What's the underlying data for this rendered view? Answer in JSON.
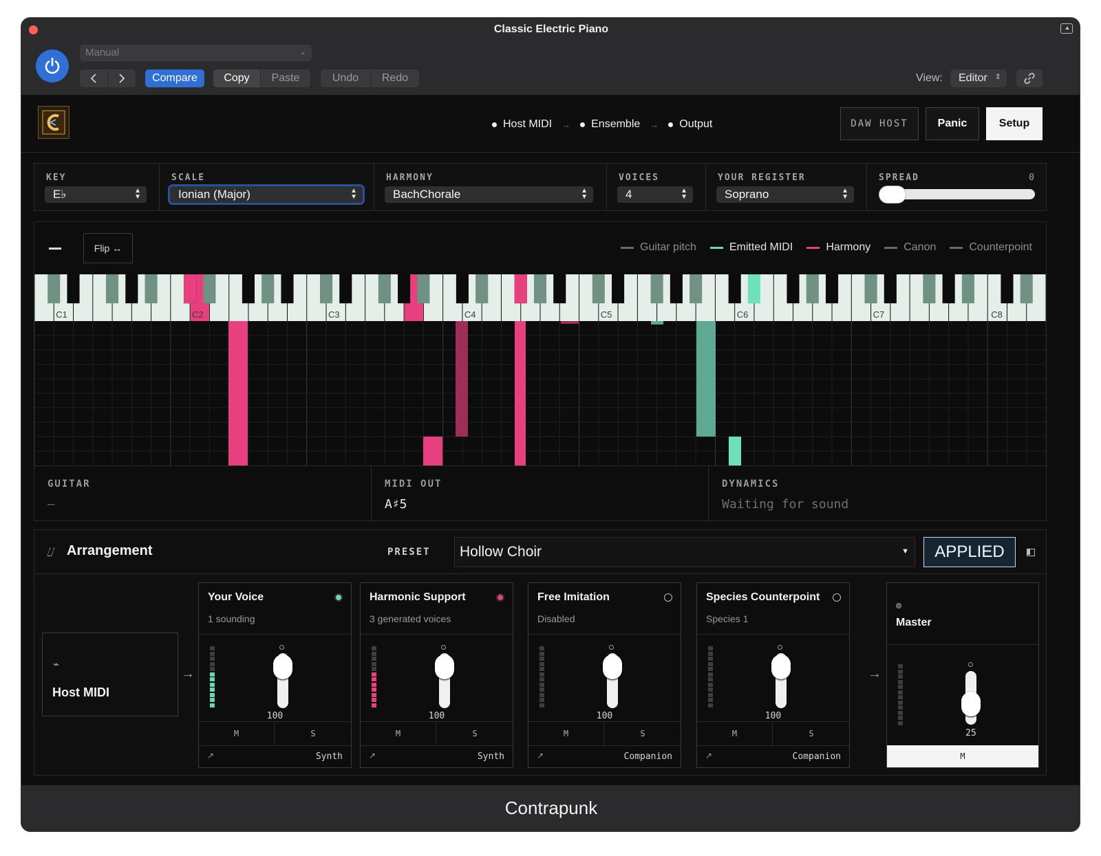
{
  "window": {
    "title": "Classic Electric Piano"
  },
  "host_toolbar": {
    "preset_select_value": "Manual",
    "compare_label": "Compare",
    "copy_label": "Copy",
    "paste_label": "Paste",
    "undo_label": "Undo",
    "redo_label": "Redo",
    "view_label": "View:",
    "view_value": "Editor"
  },
  "plugin_header": {
    "flow": [
      "Host MIDI",
      "Ensemble",
      "Output"
    ],
    "daw_host_label": "DAW HOST",
    "panic_label": "Panic",
    "setup_label": "Setup"
  },
  "controls": {
    "key": {
      "label": "KEY",
      "value": "E♭"
    },
    "scale": {
      "label": "SCALE",
      "value": "Ionian (Major)"
    },
    "harmony": {
      "label": "HARMONY",
      "value": "BachChorale"
    },
    "voices": {
      "label": "VOICES",
      "value": "4"
    },
    "register": {
      "label": "YOUR REGISTER",
      "value": "Soprano"
    },
    "spread": {
      "label": "SPREAD",
      "value": "0"
    }
  },
  "keyboard": {
    "flip_label": "Flip ↔",
    "legend": [
      {
        "name": "Guitar pitch",
        "color": "#6a6a6c"
      },
      {
        "name": "Emitted MIDI",
        "color": "#6fd6b4"
      },
      {
        "name": "Harmony",
        "color": "#e8407f"
      },
      {
        "name": "Canon",
        "color": "#6a6a6c"
      },
      {
        "name": "Counterpoint",
        "color": "#6a6a6c"
      }
    ],
    "octave_labels": [
      "C1",
      "C2",
      "C3",
      "C4",
      "C5",
      "C6",
      "C7",
      "C8"
    ],
    "colors": {
      "harmony": "#e8407f",
      "harmony_dim": "#9c2f58",
      "emitted": "#5fa894",
      "emitted_bright": "#6fe0bc",
      "white_key": "#e6eee9",
      "black_key": "#0c0c0d",
      "black_key_tint": "#6f9285"
    }
  },
  "readouts": {
    "guitar": {
      "label": "GUITAR",
      "value": "—"
    },
    "midi_out": {
      "label": "MIDI OUT",
      "value": "A♯5"
    },
    "dynamics": {
      "label": "DYNAMICS",
      "value": "Waiting for sound"
    }
  },
  "arrangement": {
    "title": "Arrangement",
    "preset_label": "PRESET",
    "preset_value": "Hollow Choir",
    "applied_label": "APPLIED",
    "source_label": "Host MIDI",
    "channels": [
      {
        "title": "Your Voice",
        "subtitle": "1 sounding",
        "status_color": "#6fd6b4",
        "status": "active",
        "meter_lit": 7,
        "meter_color": "#6fd6b4",
        "fader_value": "100",
        "mute_label": "M",
        "solo_label": "S",
        "type": "Synth"
      },
      {
        "title": "Harmonic Support",
        "subtitle": "3 generated voices",
        "status_color": "#e8407f",
        "status": "active",
        "meter_lit": 7,
        "meter_color": "#e8407f",
        "fader_value": "100",
        "mute_label": "M",
        "solo_label": "S",
        "type": "Synth"
      },
      {
        "title": "Free Imitation",
        "subtitle": "Disabled",
        "status_color": "#bbbbbb",
        "status": "off",
        "meter_lit": 0,
        "meter_color": "#3e3e40",
        "fader_value": "100",
        "mute_label": "M",
        "solo_label": "S",
        "type": "Companion"
      },
      {
        "title": "Species Counterpoint",
        "subtitle": "Species 1",
        "status_color": "#bbbbbb",
        "status": "off",
        "meter_lit": 0,
        "meter_color": "#3e3e40",
        "fader_value": "100",
        "mute_label": "M",
        "solo_label": "S",
        "type": "Companion"
      }
    ],
    "master": {
      "title": "Master",
      "fader_value": "25",
      "mute_label": "M"
    }
  },
  "footer": {
    "brand": "Contrapunk"
  }
}
